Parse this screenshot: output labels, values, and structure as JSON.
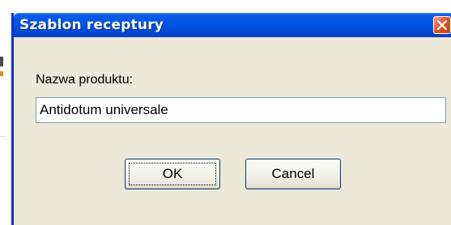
{
  "dialog": {
    "title": "Szablon receptury",
    "close_icon": "close-icon",
    "field_label": "Nazwa produktu:",
    "field_value": "Antidotum universale",
    "ok_label": "OK",
    "cancel_label": "Cancel"
  },
  "colors": {
    "titlebar": "#0055e5",
    "dialog_bg": "#ece9d8",
    "close_button": "#e2542a",
    "field_border": "#7f9db9"
  }
}
